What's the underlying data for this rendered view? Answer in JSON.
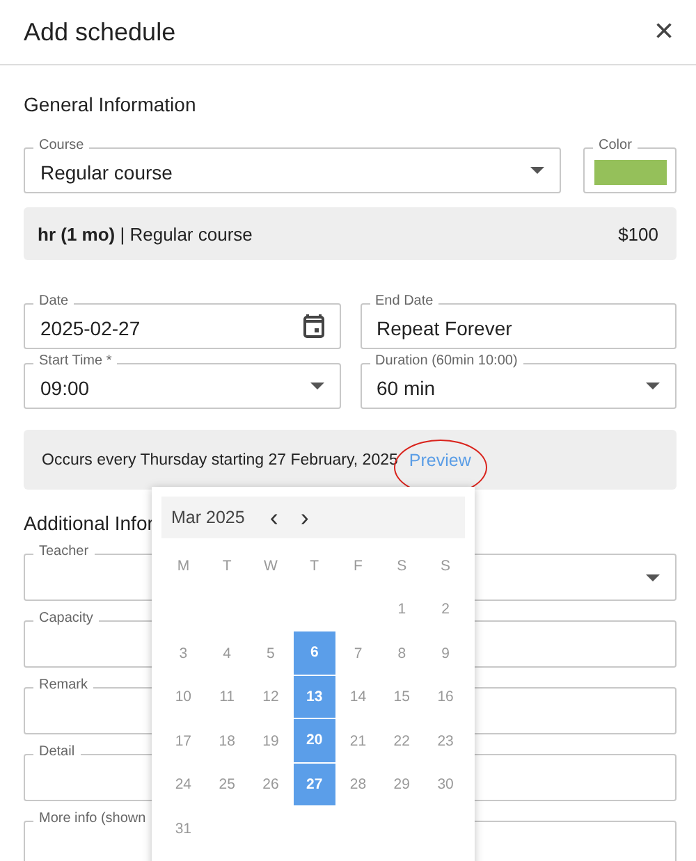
{
  "dialog": {
    "title": "Add schedule",
    "close": "×"
  },
  "general": {
    "heading": "General Information",
    "course": {
      "label": "Course",
      "value": "Regular course"
    },
    "color": {
      "label": "Color",
      "color": "#95c05a"
    },
    "summary": {
      "text": "**hr (1 mo)** | Regular course",
      "price": "$100"
    },
    "date": {
      "label": "Date",
      "value": "2025-02-27"
    },
    "end_date": {
      "label": "End Date",
      "value": "Repeat Forever"
    },
    "start_time": {
      "label": "Start Time *",
      "value": "09:00"
    },
    "duration": {
      "label": "Duration (60min 10:00)",
      "value": "60 min"
    },
    "recurrence": {
      "text": "Occurs every Thursday starting 27 February, 2025",
      "link": "Preview"
    }
  },
  "additional": {
    "heading": "Additional Infor",
    "fields": [
      {
        "label": "Teacher",
        "kind": "select"
      },
      {
        "label": "Capacity",
        "kind": "text"
      },
      {
        "label": "Remark",
        "kind": "text"
      },
      {
        "label": "Detail",
        "kind": "text"
      },
      {
        "label": "More info (shown",
        "kind": "text"
      }
    ]
  },
  "calendar": {
    "month": "Mar 2025",
    "prev": "‹",
    "next": "›",
    "weekdays": [
      "M",
      "T",
      "W",
      "T",
      "F",
      "S",
      "S"
    ],
    "weeks": [
      [
        {
          "day": "1",
          "selected": false
        },
        {
          "day": "2",
          "selected": false
        }
      ],
      [
        {
          "day": "3",
          "selected": false
        },
        {
          "day": "4",
          "selected": false
        },
        {
          "day": "5",
          "selected": false
        },
        {
          "day": "6",
          "selected": true
        },
        {
          "day": "7",
          "selected": false
        },
        {
          "day": "8",
          "selected": false
        },
        {
          "day": "9",
          "selected": false
        }
      ],
      [
        {
          "day": "10",
          "selected": false
        },
        {
          "day": "11",
          "selected": false
        },
        {
          "day": "12",
          "selected": false
        },
        {
          "day": "13",
          "selected": true
        },
        {
          "day": "14",
          "selected": false
        },
        {
          "day": "15",
          "selected": false
        },
        {
          "day": "16",
          "selected": false
        }
      ],
      [
        {
          "day": "17",
          "selected": false
        },
        {
          "day": "18",
          "selected": false
        },
        {
          "day": "19",
          "selected": false
        },
        {
          "day": "20",
          "selected": true
        },
        {
          "day": "21",
          "selected": false
        },
        {
          "day": "22",
          "selected": false
        },
        {
          "day": "23",
          "selected": false
        }
      ],
      [
        {
          "day": "24",
          "selected": false
        },
        {
          "day": "25",
          "selected": false
        },
        {
          "day": "26",
          "selected": false
        },
        {
          "day": "27",
          "selected": true
        },
        {
          "day": "28",
          "selected": false
        },
        {
          "day": "29",
          "selected": false
        },
        {
          "day": "30",
          "selected": false
        }
      ],
      [
        {
          "day": "31",
          "selected": false
        }
      ]
    ]
  }
}
